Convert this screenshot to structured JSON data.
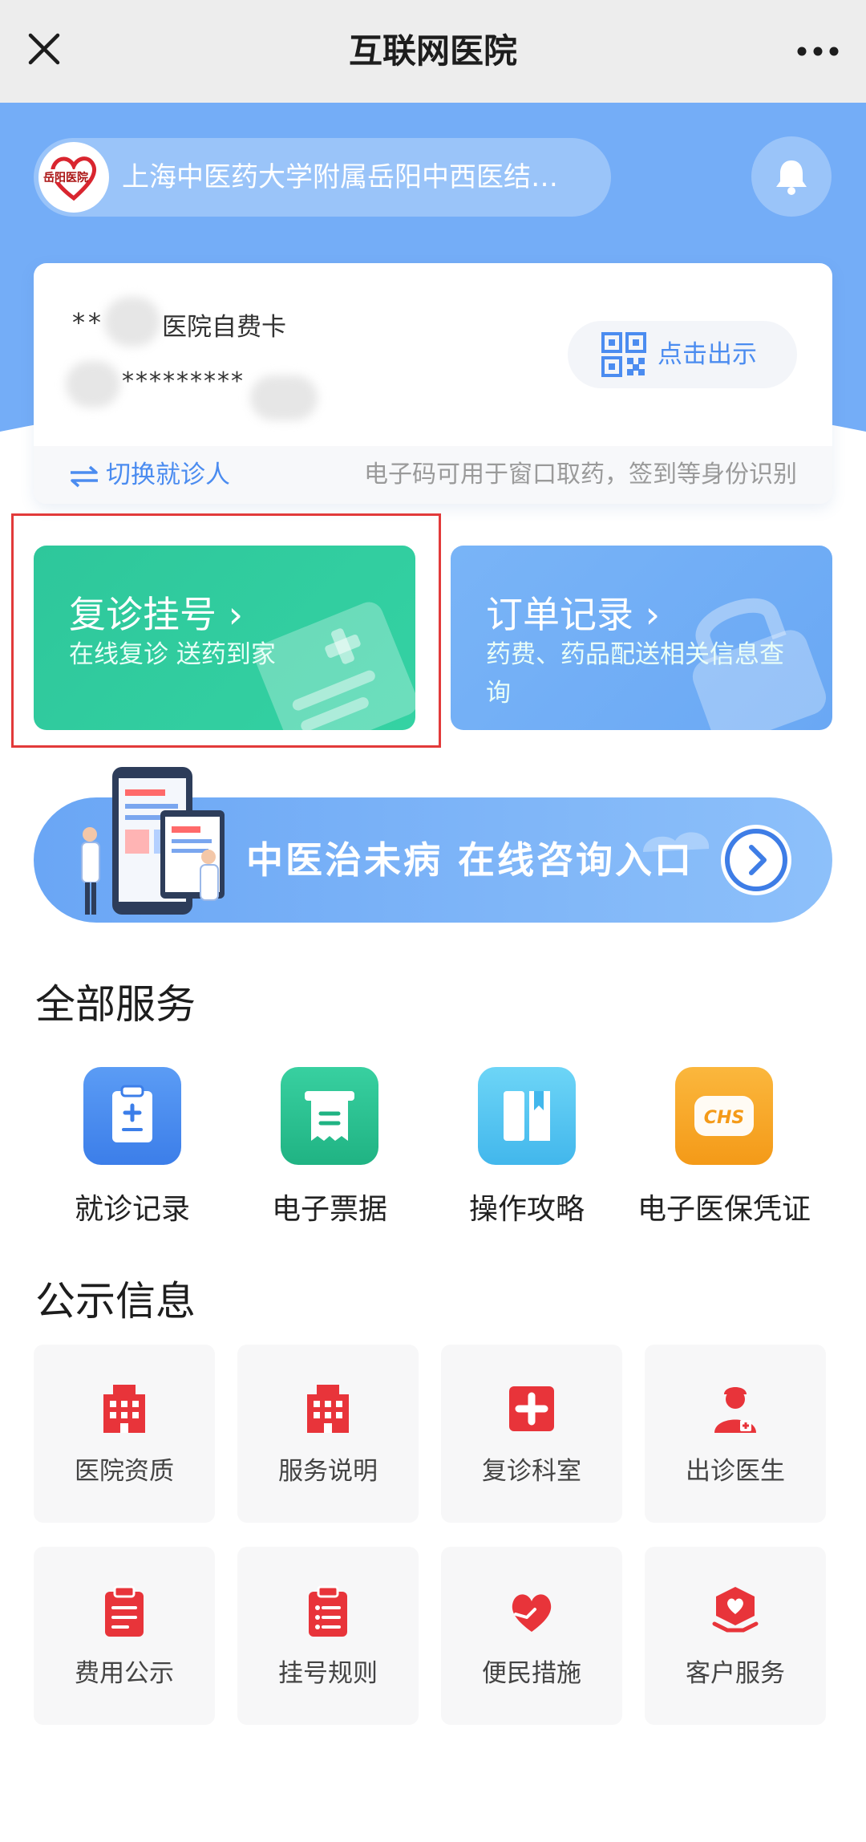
{
  "nav": {
    "title": "互联网医院",
    "close_icon": "close-icon",
    "more_icon": "more-horizontal-icon"
  },
  "header": {
    "hospital_name": "上海中医药大学附属岳阳中西医结…",
    "logo_text": "岳阳医院",
    "bell_icon": "bell-icon",
    "bg_color": "#74adf7"
  },
  "patient_card": {
    "name_mask": "**",
    "card_type": "医院自费卡",
    "card_number_mask": "*********",
    "show_code_label": "点击出示",
    "switch_patient_label": "切换就诊人",
    "hint": "电子码可用于窗口取药，签到等身份识别"
  },
  "actions": [
    {
      "title": "复诊挂号",
      "subtitle": "在线复诊 送药到家",
      "color": "#2fc89c"
    },
    {
      "title": "订单记录",
      "subtitle": "药费、药品配送相关信息查询",
      "color": "#72aef6"
    }
  ],
  "consult_banner": {
    "text": "中医治未病 在线咨询入口"
  },
  "services": {
    "title": "全部服务",
    "items": [
      {
        "label": "就诊记录",
        "icon": "clipboard-icon",
        "color": "#4a8cf0"
      },
      {
        "label": "电子票据",
        "icon": "receipt-icon",
        "color": "#2dbf8c"
      },
      {
        "label": "操作攻略",
        "icon": "book-icon",
        "color": "#54c6f0"
      },
      {
        "label": "电子医保凭证",
        "icon": "chs-icon",
        "color": "#f7a623"
      }
    ]
  },
  "notices": {
    "title": "公示信息",
    "items": [
      {
        "label": "医院资质",
        "icon": "hospital-building-icon"
      },
      {
        "label": "服务说明",
        "icon": "building-icon"
      },
      {
        "label": "复诊科室",
        "icon": "medical-cross-icon"
      },
      {
        "label": "出诊医生",
        "icon": "doctor-icon"
      },
      {
        "label": "费用公示",
        "icon": "fee-clipboard-icon"
      },
      {
        "label": "挂号规则",
        "icon": "rules-list-icon"
      },
      {
        "label": "便民措施",
        "icon": "heart-hands-icon"
      },
      {
        "label": "客户服务",
        "icon": "customer-service-icon"
      }
    ],
    "icon_color": "#e8343a"
  }
}
